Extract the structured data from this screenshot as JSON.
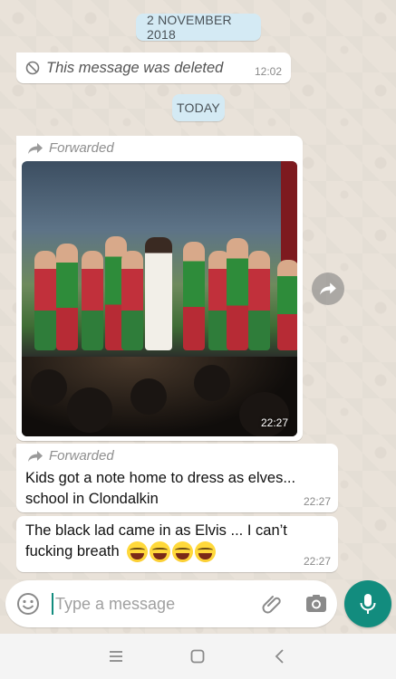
{
  "chat": {
    "date_chip_1": "2 NOVEMBER 2018",
    "deleted_message": {
      "text": "This message was deleted",
      "time": "12:02",
      "icon": "ban-icon"
    },
    "date_chip_2": "TODAY",
    "photo_message": {
      "forwarded_label": "Forwarded",
      "time": "22:27"
    },
    "text_message_1": {
      "forwarded_label": "Forwarded",
      "line1": "Kids got a note home to dress as elves...",
      "line2": "school in Clondalkin",
      "time": "22:27"
    },
    "text_message_2": {
      "line1": "The black lad came in as Elvis ... I can’t",
      "line2": "fucking breath",
      "emojis": [
        "grinning-squinting-face",
        "grinning-squinting-face",
        "grinning-squinting-face",
        "grinning-squinting-face"
      ],
      "time": "22:27"
    }
  },
  "composer": {
    "placeholder": "Type a message",
    "icons": [
      "smiley-icon",
      "paperclip-icon",
      "camera-icon",
      "mic-icon"
    ]
  },
  "navbar": {
    "icons": [
      "recents-icon",
      "home-icon",
      "back-icon"
    ]
  },
  "colors": {
    "accent": "#128c7e",
    "chip": "#d4eaf4",
    "bubble": "#ffffff",
    "chat_bg": "#e9e2d9"
  }
}
